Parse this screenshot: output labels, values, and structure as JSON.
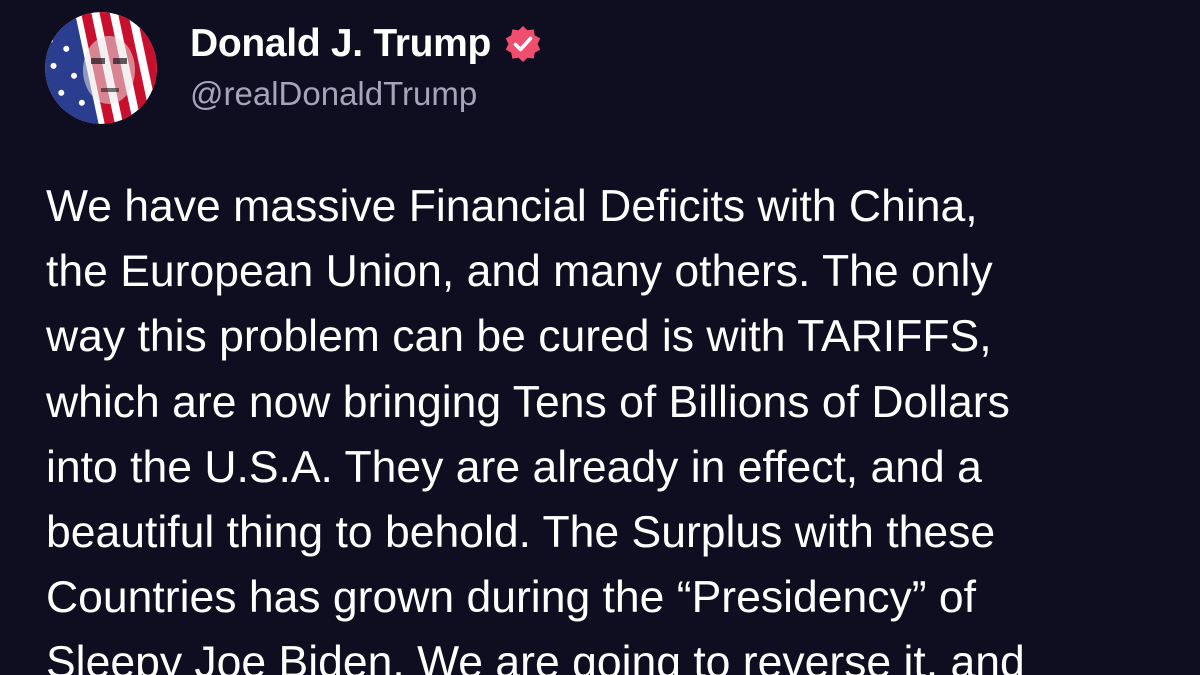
{
  "post": {
    "author": {
      "display_name": "Donald J. Trump",
      "handle": "@realDonaldTrump",
      "verified_color": "#f04e6e"
    },
    "body_lines": [
      "We have massive Financial Deficits with China,",
      "the European Union, and many others. The only",
      "way this problem can be cured is with TARIFFS,",
      "which are now bringing Tens of Billions of Dollars",
      "into the U.S.A. They are already in effect, and a",
      "beautiful thing to behold. The Surplus with these",
      "Countries has grown during the “Presidency” of",
      "Sleepy Joe Biden. We are going to reverse it, and"
    ]
  },
  "colors": {
    "background": "#0f0d20",
    "text": "#ffffff",
    "handle": "#a7a3b8"
  }
}
